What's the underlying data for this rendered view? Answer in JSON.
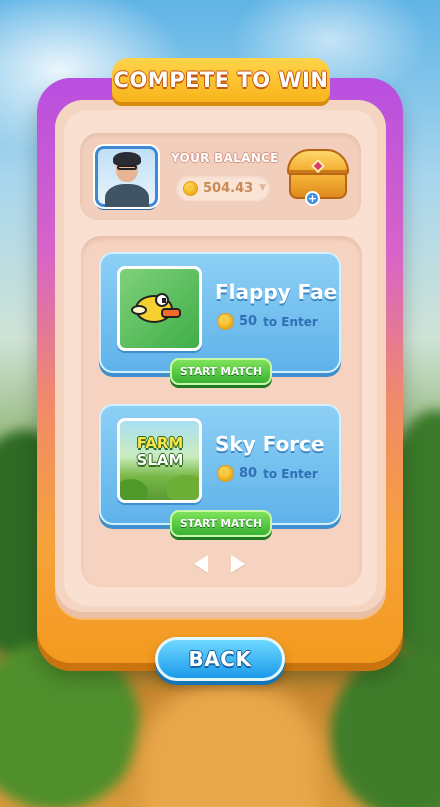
{
  "header": {
    "title": "COMPETE TO WIN"
  },
  "player": {
    "balance_label": "YOUR BALANCE",
    "balance_value": "504.43",
    "avatar_icon": "player-avatar",
    "chest_icon": "treasure-chest-icon"
  },
  "games": [
    {
      "name": "Flappy Fae",
      "entry_amount": "50",
      "entry_text": "to Enter",
      "thumbnail_icon": "flappy-bird-icon",
      "button_label": "START MATCH"
    },
    {
      "name": "Sky Force",
      "entry_amount": "80",
      "entry_text": "to Enter",
      "thumbnail_icon": "farm-slam-thumbnail",
      "thumbnail_text": [
        "FARM",
        "SLAM"
      ],
      "button_label": "START MATCH"
    }
  ],
  "pagination": {
    "prev_icon": "arrow-left-icon",
    "next_icon": "arrow-right-icon"
  },
  "footer": {
    "back_label": "BACK"
  },
  "colors": {
    "card_blue": "#5fb2ea",
    "button_green": "#38b233",
    "accent_orange": "#f7b51a",
    "back_blue": "#1b9be9"
  }
}
